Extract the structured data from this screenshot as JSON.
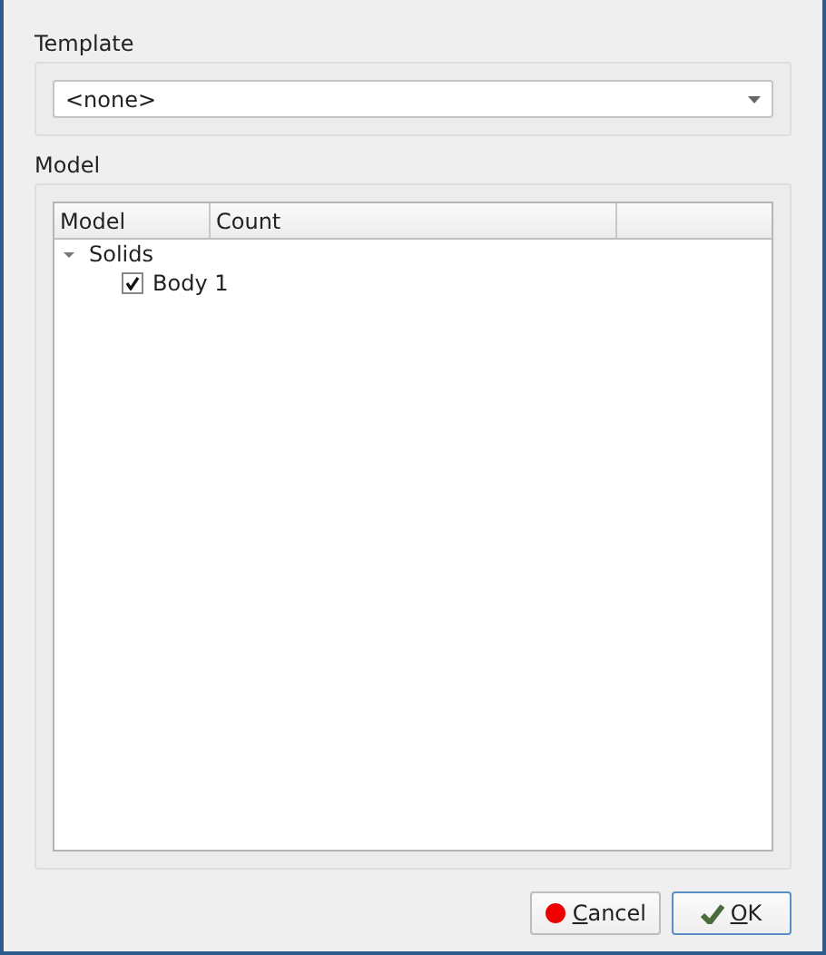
{
  "template": {
    "label": "Template",
    "value": "<none>"
  },
  "model": {
    "label": "Model",
    "columns": [
      "Model",
      "Count"
    ],
    "tree": [
      {
        "label": "Solids",
        "expanded": true,
        "children": [
          {
            "label": "Body 1",
            "checked": true
          }
        ]
      }
    ]
  },
  "buttons": [
    {
      "kind": "cancel",
      "label": "Cancel"
    },
    {
      "kind": "ok",
      "label": "OK"
    }
  ]
}
